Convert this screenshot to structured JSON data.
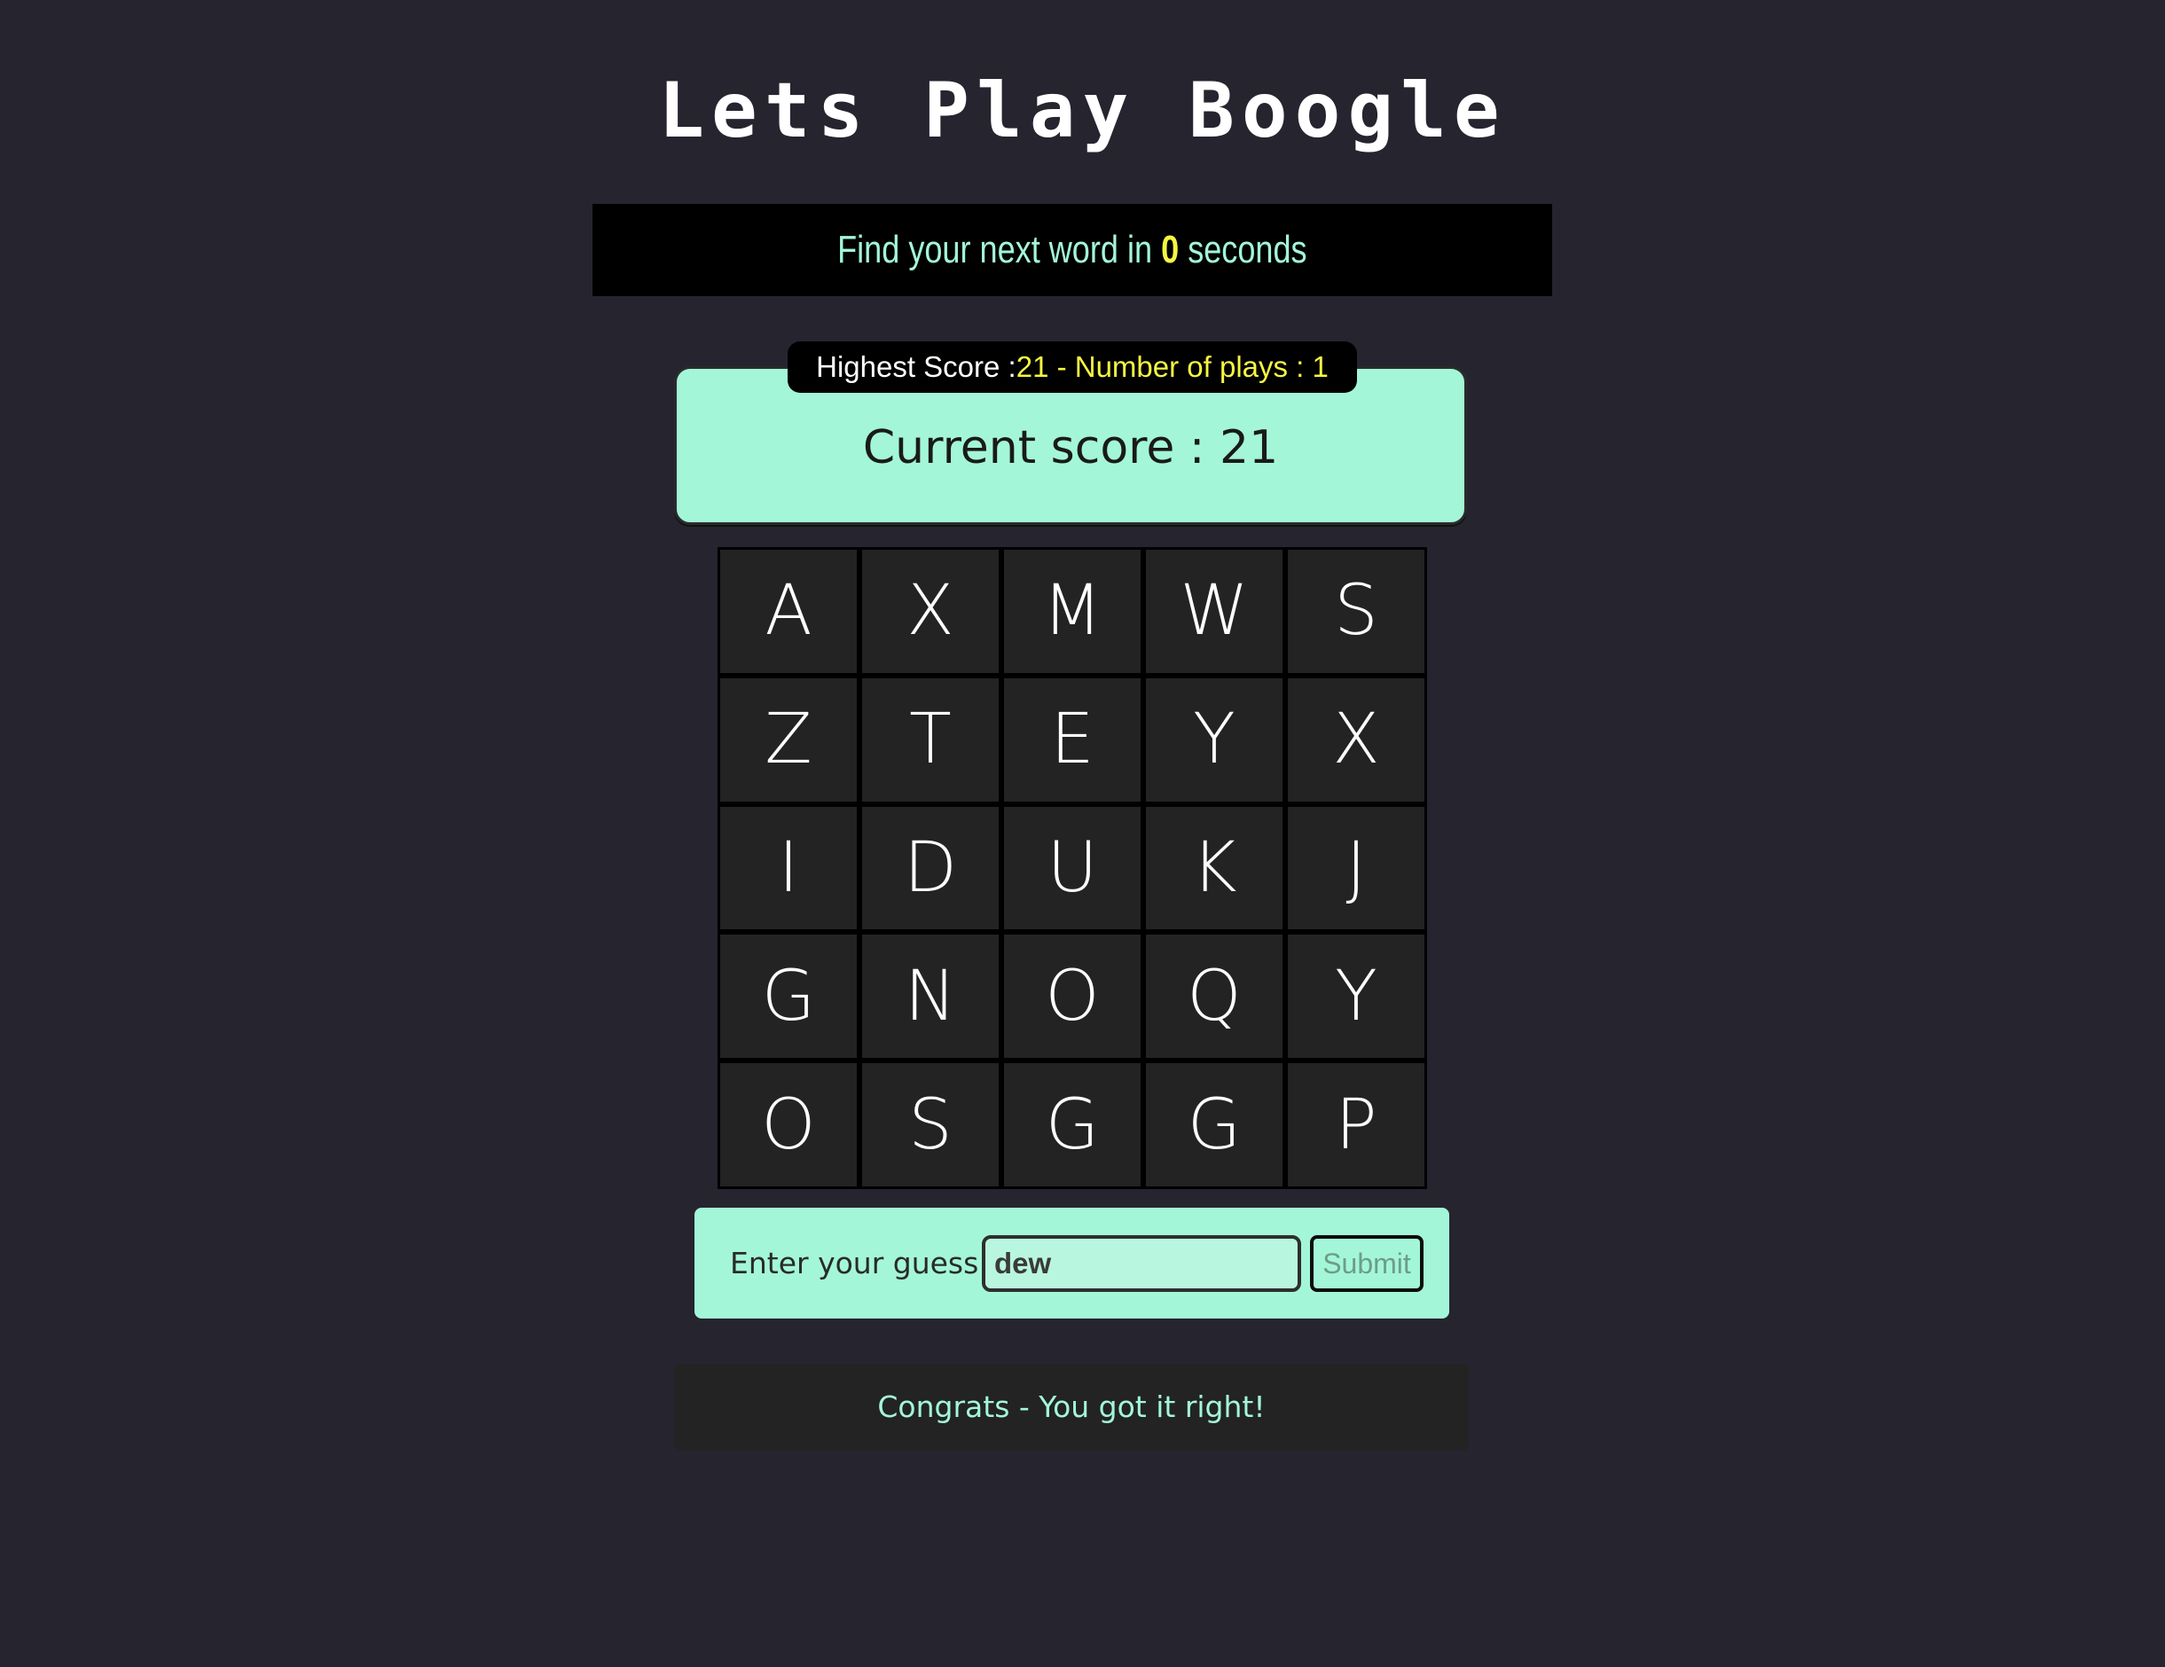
{
  "title": "Lets Play Boogle",
  "timer": {
    "prefix": "Find your next word in ",
    "seconds": "0",
    "suffix": " seconds"
  },
  "stats": {
    "highest_label": "Highest Score : ",
    "highest_value": "21 - Number of plays : 1"
  },
  "current_score": "Current score : 21",
  "board": [
    [
      "A",
      "X",
      "M",
      "W",
      "S"
    ],
    [
      "Z",
      "T",
      "E",
      "Y",
      "X"
    ],
    [
      "I",
      "D",
      "U",
      "K",
      "J"
    ],
    [
      "G",
      "N",
      "O",
      "Q",
      "Y"
    ],
    [
      "O",
      "S",
      "G",
      "G",
      "P"
    ]
  ],
  "guess": {
    "label": "Enter your guess :",
    "value": "dew",
    "submit_label": "Submit"
  },
  "message": "Congrats - You got it right!",
  "colors": {
    "background": "#25242f",
    "accent": "#a3f7d8",
    "highlight": "#f5f542",
    "tile": "#232323"
  }
}
